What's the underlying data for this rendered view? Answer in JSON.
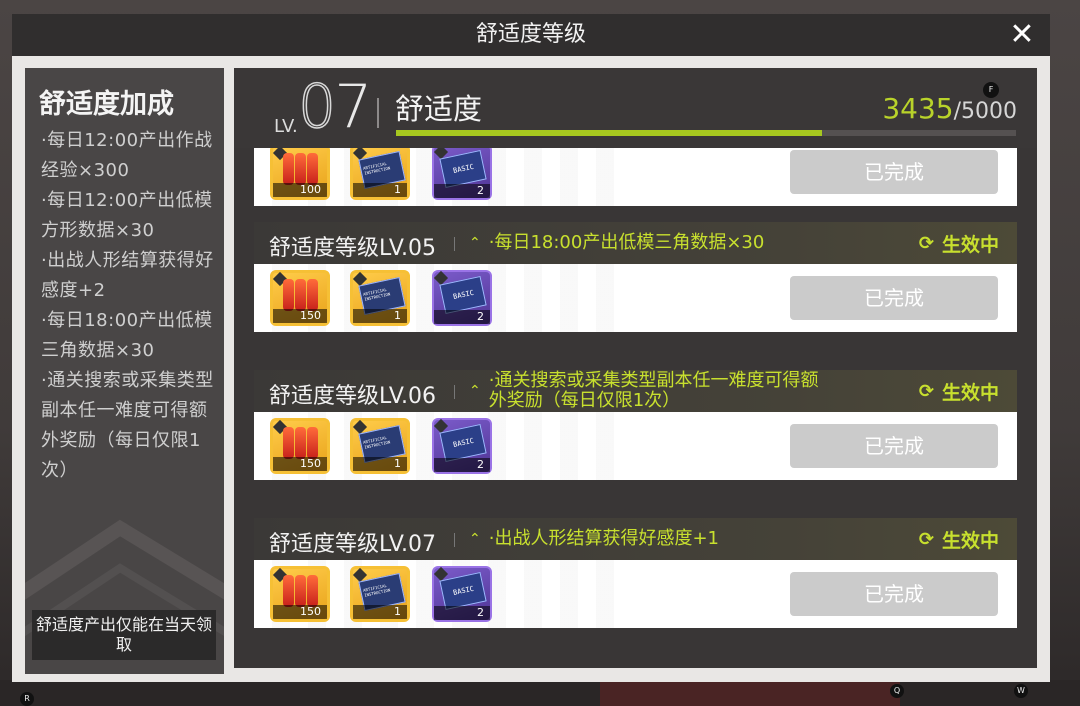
{
  "window": {
    "title": "舒适度等级",
    "close_icon": "close-icon"
  },
  "sidebar": {
    "title": "舒适度加成",
    "items": [
      "·每日12:00产出作战经验×300",
      "·每日12:00产出低模方形数据×30",
      "·出战人形结算获得好感度+2",
      "·每日18:00产出低模三角数据×30",
      "·通关搜索或采集类型副本任一难度可得额外奖励（每日仅限1次）"
    ],
    "note": "舒适度产出仅能在当天领取"
  },
  "level_header": {
    "prefix": "LV.",
    "level": "07",
    "label": "舒适度",
    "score": "3435",
    "max": "/5000",
    "progress": 0.687,
    "hotkey": "F"
  },
  "rows": [
    {
      "title": "",
      "bonus": "",
      "status": "",
      "items": [
        {
          "icon": "ammo-box-icon",
          "count": "100"
        },
        {
          "icon": "data-card-icon",
          "count": "1"
        },
        {
          "icon": "basic-card-icon",
          "count": "2"
        }
      ],
      "button": "已完成"
    },
    {
      "title": "舒适度等级LV.05",
      "bonus": "·每日18:00产出低模三角数据×30",
      "status": "生效中",
      "items": [
        {
          "icon": "ammo-box-icon",
          "count": "150"
        },
        {
          "icon": "data-card-icon",
          "count": "1"
        },
        {
          "icon": "basic-card-icon",
          "count": "2"
        }
      ],
      "button": "已完成"
    },
    {
      "title": "舒适度等级LV.06",
      "bonus": "·通关搜索或采集类型副本任一难度可得额外奖励（每日仅限1次）",
      "status": "生效中",
      "items": [
        {
          "icon": "ammo-box-icon",
          "count": "150"
        },
        {
          "icon": "data-card-icon",
          "count": "1"
        },
        {
          "icon": "basic-card-icon",
          "count": "2"
        }
      ],
      "button": "已完成"
    },
    {
      "title": "舒适度等级LV.07",
      "bonus": "·出战人形结算获得好感度+1",
      "status": "生效中",
      "items": [
        {
          "icon": "ammo-box-icon",
          "count": "150"
        },
        {
          "icon": "data-card-icon",
          "count": "1"
        },
        {
          "icon": "basic-card-icon",
          "count": "2"
        }
      ],
      "button": "已完成"
    }
  ],
  "card_text": {
    "data_card": "ARTIFICIAL INSTRUCTION",
    "basic_card": "BASIC"
  },
  "hotkeys": {
    "r": "R",
    "q": "Q",
    "w": "W"
  },
  "colors": {
    "accent": "#b9d32a",
    "status": "#c8e02e",
    "gold_frame": "#f6c035",
    "purple_frame": "#9a73e6"
  }
}
